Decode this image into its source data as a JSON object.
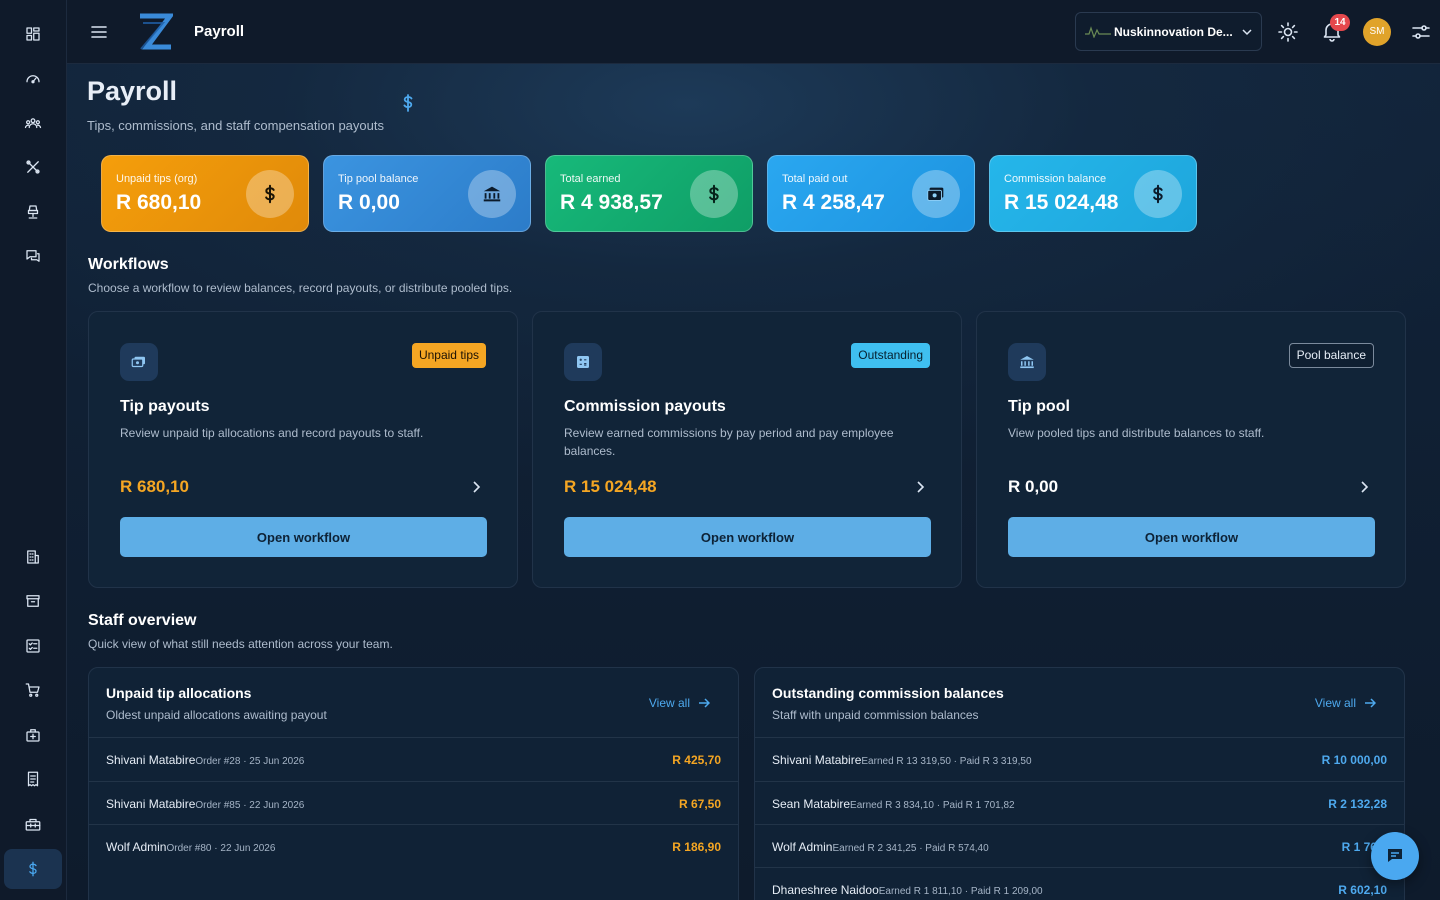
{
  "app": {
    "title": "Payroll"
  },
  "header": {
    "org_name": "Nuskinnovation De...",
    "notifications_count": "14",
    "avatar_initials": "SM"
  },
  "sidebar": {
    "items": [
      {
        "icon": "dashboard-icon",
        "active": false
      },
      {
        "icon": "gauge-icon",
        "active": false
      },
      {
        "icon": "team-icon",
        "active": false
      },
      {
        "icon": "tools-icon",
        "active": false
      },
      {
        "icon": "salon-chair-icon",
        "active": false
      },
      {
        "icon": "chat-icon",
        "active": false
      },
      {
        "icon": "building-icon",
        "active": false
      },
      {
        "icon": "archive-icon",
        "active": false
      },
      {
        "icon": "checklist-icon",
        "active": false
      },
      {
        "icon": "cart-icon",
        "active": false
      },
      {
        "icon": "medical-bag-icon",
        "active": false
      },
      {
        "icon": "receipt-icon",
        "active": false
      },
      {
        "icon": "toolbox-icon",
        "active": false
      },
      {
        "icon": "dollar-icon",
        "active": true
      }
    ]
  },
  "page": {
    "title": "Payroll",
    "subtitle": "Tips, commissions, and staff compensation payouts"
  },
  "stats": [
    {
      "label": "Unpaid tips (org)",
      "value": "R 680,10",
      "icon": "dollar-icon",
      "color": "#f59e0b"
    },
    {
      "label": "Tip pool balance",
      "value": "R 0,00",
      "icon": "bank-icon",
      "color": "#3b8fdb"
    },
    {
      "label": "Total earned",
      "value": "R 4 938,57",
      "icon": "dollar-icon",
      "color": "#15b374"
    },
    {
      "label": "Total paid out",
      "value": "R 4 258,47",
      "icon": "cash-icon",
      "color": "#2aa5ee"
    },
    {
      "label": "Commission balance",
      "value": "R 15 024,48",
      "icon": "dollar-icon",
      "color": "#22b3e6"
    }
  ],
  "workflows": {
    "heading": "Workflows",
    "subtitle": "Choose a workflow to review balances, record payouts, or distribute pooled tips.",
    "cards": [
      {
        "badge": "Unpaid tips",
        "title": "Tip payouts",
        "desc": "Review unpaid tip allocations and record payouts to staff.",
        "amount": "R 680,10",
        "button": "Open workflow",
        "icon": "cash-icon"
      },
      {
        "badge": "Outstanding",
        "title": "Commission payouts",
        "desc": "Review earned commissions by pay period and pay employee balances.",
        "amount": "R 15 024,48",
        "button": "Open workflow",
        "icon": "calculator-icon"
      },
      {
        "badge": "Pool balance",
        "title": "Tip pool",
        "desc": "View pooled tips and distribute balances to staff.",
        "amount": "R 0,00",
        "button": "Open workflow",
        "icon": "bank-icon"
      }
    ]
  },
  "staff": {
    "heading": "Staff overview",
    "subtitle": "Quick view of what still needs attention across your team.",
    "unpaid": {
      "title": "Unpaid tip allocations",
      "subtitle": "Oldest unpaid allocations awaiting payout",
      "view_all": "View all",
      "rows": [
        {
          "name": "Shivani Matabire",
          "meta": "Order #28 · 25 Jun 2026",
          "amount": "R 425,70"
        },
        {
          "name": "Shivani Matabire",
          "meta": "Order #85 · 22 Jun 2026",
          "amount": "R 67,50"
        },
        {
          "name": "Wolf Admin",
          "meta": "Order #80 · 22 Jun 2026",
          "amount": "R 186,90"
        }
      ]
    },
    "commission": {
      "title": "Outstanding commission balances",
      "subtitle": "Staff with unpaid commission balances",
      "view_all": "View all",
      "rows": [
        {
          "name": "Shivani Matabire",
          "meta": "Earned R 13 319,50 · Paid R 3 319,50",
          "amount": "R 10 000,00"
        },
        {
          "name": "Sean Matabire",
          "meta": "Earned R 3 834,10 · Paid R 1 701,82",
          "amount": "R 2 132,28"
        },
        {
          "name": "Wolf Admin",
          "meta": "Earned R 2 341,25 · Paid R 574,40",
          "amount": "R 1 766,"
        },
        {
          "name": "Dhaneshree Naidoo",
          "meta": "Earned R 1 811,10 · Paid R 1 209,00",
          "amount": "R 602,10"
        }
      ]
    }
  }
}
